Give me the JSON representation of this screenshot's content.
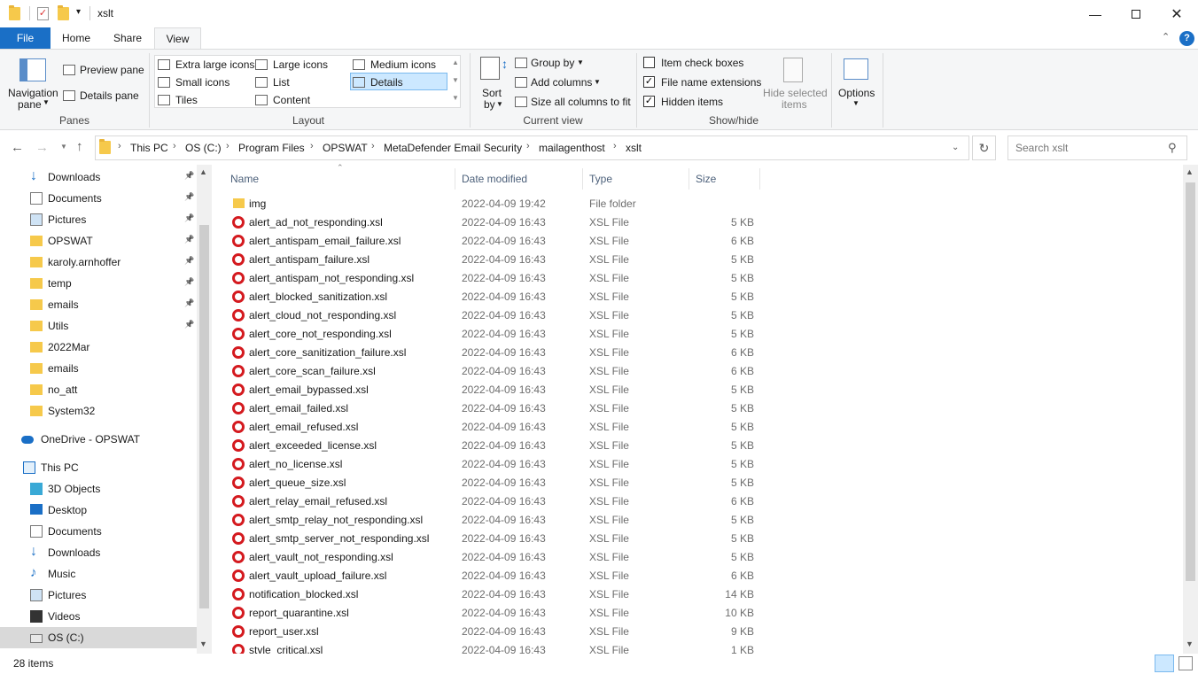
{
  "window": {
    "title": "xslt"
  },
  "tabs": {
    "file": "File",
    "home": "Home",
    "share": "Share",
    "view": "View"
  },
  "ribbon": {
    "panes": {
      "navigation_pane": "Navigation",
      "navigation_pane2": "pane",
      "preview_pane": "Preview pane",
      "details_pane": "Details pane",
      "label": "Panes"
    },
    "layout": {
      "extra_large": "Extra large icons",
      "large": "Large icons",
      "medium": "Medium icons",
      "small": "Small icons",
      "list": "List",
      "details": "Details",
      "tiles": "Tiles",
      "content": "Content",
      "label": "Layout",
      "selected": "Details"
    },
    "current_view": {
      "sort": "Sort",
      "sort_by": "by",
      "group_by": "Group by",
      "add_columns": "Add columns",
      "size_all": "Size all columns to fit",
      "label": "Current view"
    },
    "show_hide": {
      "item_check_boxes": "Item check boxes",
      "file_name_extensions": "File name extensions",
      "hidden_items": "Hidden items",
      "hide_selected": "Hide selected",
      "hide_selected2": "items",
      "label": "Show/hide"
    },
    "options": {
      "label": "Options"
    }
  },
  "address": {
    "crumbs": [
      "This PC",
      "OS (C:)",
      "Program Files",
      "OPSWAT",
      "MetaDefender Email Security",
      "mailagenthost",
      "xslt"
    ],
    "search_placeholder": "Search xslt"
  },
  "nav": {
    "quick_access": [
      {
        "label": "Downloads",
        "pinned": true
      },
      {
        "label": "Documents",
        "pinned": true
      },
      {
        "label": "Pictures",
        "pinned": true
      },
      {
        "label": "OPSWAT",
        "pinned": true
      },
      {
        "label": "karoly.arnhoffer",
        "pinned": true
      },
      {
        "label": "temp",
        "pinned": true
      },
      {
        "label": "emails",
        "pinned": true
      },
      {
        "label": "Utils",
        "pinned": true
      },
      {
        "label": "2022Mar",
        "pinned": false
      },
      {
        "label": "emails",
        "pinned": false
      },
      {
        "label": "no_att",
        "pinned": false
      },
      {
        "label": "System32",
        "pinned": false
      }
    ],
    "onedrive": "OneDrive - OPSWAT",
    "this_pc": "This PC",
    "pc_items": [
      "3D Objects",
      "Desktop",
      "Documents",
      "Downloads",
      "Music",
      "Pictures",
      "Videos",
      "OS (C:)"
    ]
  },
  "columns": {
    "name": "Name",
    "date": "Date modified",
    "type": "Type",
    "size": "Size"
  },
  "files": [
    {
      "name": "img",
      "date": "2022-04-09 19:42",
      "type": "File folder",
      "size": "",
      "kind": "folder"
    },
    {
      "name": "alert_ad_not_responding.xsl",
      "date": "2022-04-09 16:43",
      "type": "XSL File",
      "size": "5 KB",
      "kind": "xsl"
    },
    {
      "name": "alert_antispam_email_failure.xsl",
      "date": "2022-04-09 16:43",
      "type": "XSL File",
      "size": "6 KB",
      "kind": "xsl"
    },
    {
      "name": "alert_antispam_failure.xsl",
      "date": "2022-04-09 16:43",
      "type": "XSL File",
      "size": "5 KB",
      "kind": "xsl"
    },
    {
      "name": "alert_antispam_not_responding.xsl",
      "date": "2022-04-09 16:43",
      "type": "XSL File",
      "size": "5 KB",
      "kind": "xsl"
    },
    {
      "name": "alert_blocked_sanitization.xsl",
      "date": "2022-04-09 16:43",
      "type": "XSL File",
      "size": "5 KB",
      "kind": "xsl"
    },
    {
      "name": "alert_cloud_not_responding.xsl",
      "date": "2022-04-09 16:43",
      "type": "XSL File",
      "size": "5 KB",
      "kind": "xsl"
    },
    {
      "name": "alert_core_not_responding.xsl",
      "date": "2022-04-09 16:43",
      "type": "XSL File",
      "size": "5 KB",
      "kind": "xsl"
    },
    {
      "name": "alert_core_sanitization_failure.xsl",
      "date": "2022-04-09 16:43",
      "type": "XSL File",
      "size": "6 KB",
      "kind": "xsl"
    },
    {
      "name": "alert_core_scan_failure.xsl",
      "date": "2022-04-09 16:43",
      "type": "XSL File",
      "size": "6 KB",
      "kind": "xsl"
    },
    {
      "name": "alert_email_bypassed.xsl",
      "date": "2022-04-09 16:43",
      "type": "XSL File",
      "size": "5 KB",
      "kind": "xsl"
    },
    {
      "name": "alert_email_failed.xsl",
      "date": "2022-04-09 16:43",
      "type": "XSL File",
      "size": "5 KB",
      "kind": "xsl"
    },
    {
      "name": "alert_email_refused.xsl",
      "date": "2022-04-09 16:43",
      "type": "XSL File",
      "size": "5 KB",
      "kind": "xsl"
    },
    {
      "name": "alert_exceeded_license.xsl",
      "date": "2022-04-09 16:43",
      "type": "XSL File",
      "size": "5 KB",
      "kind": "xsl"
    },
    {
      "name": "alert_no_license.xsl",
      "date": "2022-04-09 16:43",
      "type": "XSL File",
      "size": "5 KB",
      "kind": "xsl"
    },
    {
      "name": "alert_queue_size.xsl",
      "date": "2022-04-09 16:43",
      "type": "XSL File",
      "size": "5 KB",
      "kind": "xsl"
    },
    {
      "name": "alert_relay_email_refused.xsl",
      "date": "2022-04-09 16:43",
      "type": "XSL File",
      "size": "6 KB",
      "kind": "xsl"
    },
    {
      "name": "alert_smtp_relay_not_responding.xsl",
      "date": "2022-04-09 16:43",
      "type": "XSL File",
      "size": "5 KB",
      "kind": "xsl"
    },
    {
      "name": "alert_smtp_server_not_responding.xsl",
      "date": "2022-04-09 16:43",
      "type": "XSL File",
      "size": "5 KB",
      "kind": "xsl"
    },
    {
      "name": "alert_vault_not_responding.xsl",
      "date": "2022-04-09 16:43",
      "type": "XSL File",
      "size": "5 KB",
      "kind": "xsl"
    },
    {
      "name": "alert_vault_upload_failure.xsl",
      "date": "2022-04-09 16:43",
      "type": "XSL File",
      "size": "6 KB",
      "kind": "xsl"
    },
    {
      "name": "notification_blocked.xsl",
      "date": "2022-04-09 16:43",
      "type": "XSL File",
      "size": "14 KB",
      "kind": "xsl"
    },
    {
      "name": "report_quarantine.xsl",
      "date": "2022-04-09 16:43",
      "type": "XSL File",
      "size": "10 KB",
      "kind": "xsl"
    },
    {
      "name": "report_user.xsl",
      "date": "2022-04-09 16:43",
      "type": "XSL File",
      "size": "9 KB",
      "kind": "xsl"
    },
    {
      "name": "style_critical.xsl",
      "date": "2022-04-09 16:43",
      "type": "XSL File",
      "size": "1 KB",
      "kind": "xsl"
    }
  ],
  "status": {
    "count": "28 items"
  },
  "colors": {
    "accent": "#1a6fc6",
    "xsl_icon": "#d41a1f",
    "folder": "#f6c94b",
    "selection": "#cce8ff"
  }
}
